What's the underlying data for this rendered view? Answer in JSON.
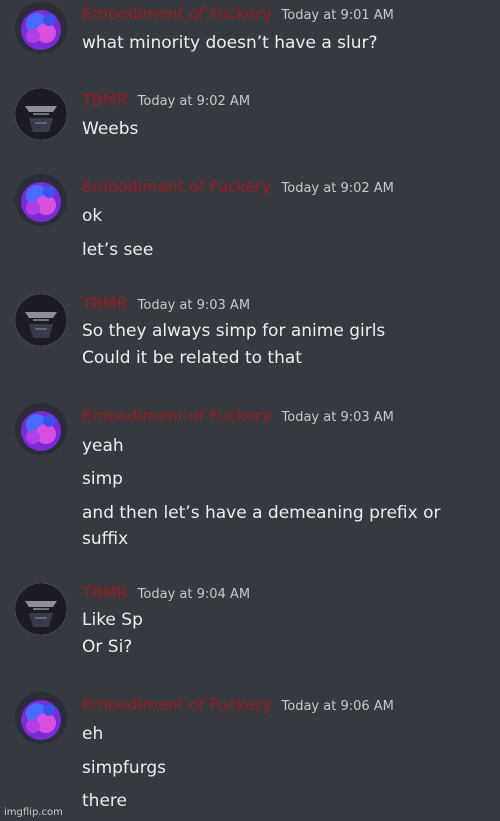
{
  "messages": [
    {
      "author": "Embodiment of Fuckery",
      "avatar": "purple-blob-avatar",
      "time": "Today at 9:01 AM",
      "lines": [
        "what minority doesn’t have a slur?"
      ]
    },
    {
      "author": "TBMR",
      "avatar": "dark-figure-avatar",
      "time": "Today at 9:02 AM",
      "lines": [
        "Weebs"
      ]
    },
    {
      "author": "Embodiment of Fuckery",
      "avatar": "purple-blob-avatar",
      "time": "Today at 9:02 AM",
      "lines": [
        "ok",
        "let’s see"
      ]
    },
    {
      "author": "TBMR",
      "avatar": "dark-figure-avatar",
      "time": "Today at 9:03 AM",
      "lines": [
        "So they always simp for anime girls",
        "Could it be related to that"
      ]
    },
    {
      "author": "Embodiment of Fuckery",
      "avatar": "purple-blob-avatar",
      "time": "Today at 9:03 AM",
      "lines": [
        "yeah",
        "simp",
        "and then let’s have a demeaning prefix or",
        "suffix"
      ]
    },
    {
      "author": "TBMR",
      "avatar": "dark-figure-avatar",
      "time": "Today at 9:04 AM",
      "lines": [
        "Like Sp",
        "Or Si?"
      ]
    },
    {
      "author": "Embodiment of Fuckery",
      "avatar": "purple-blob-avatar",
      "time": "Today at 9:06 AM",
      "lines": [
        "eh",
        "simpfurgs",
        "there"
      ]
    }
  ],
  "watermark": "imgflip.com",
  "colors": {
    "background": "#36393f",
    "username": "#9b1c1c",
    "timestamp": "#c7c9cc",
    "message_text": "#eceff1"
  }
}
